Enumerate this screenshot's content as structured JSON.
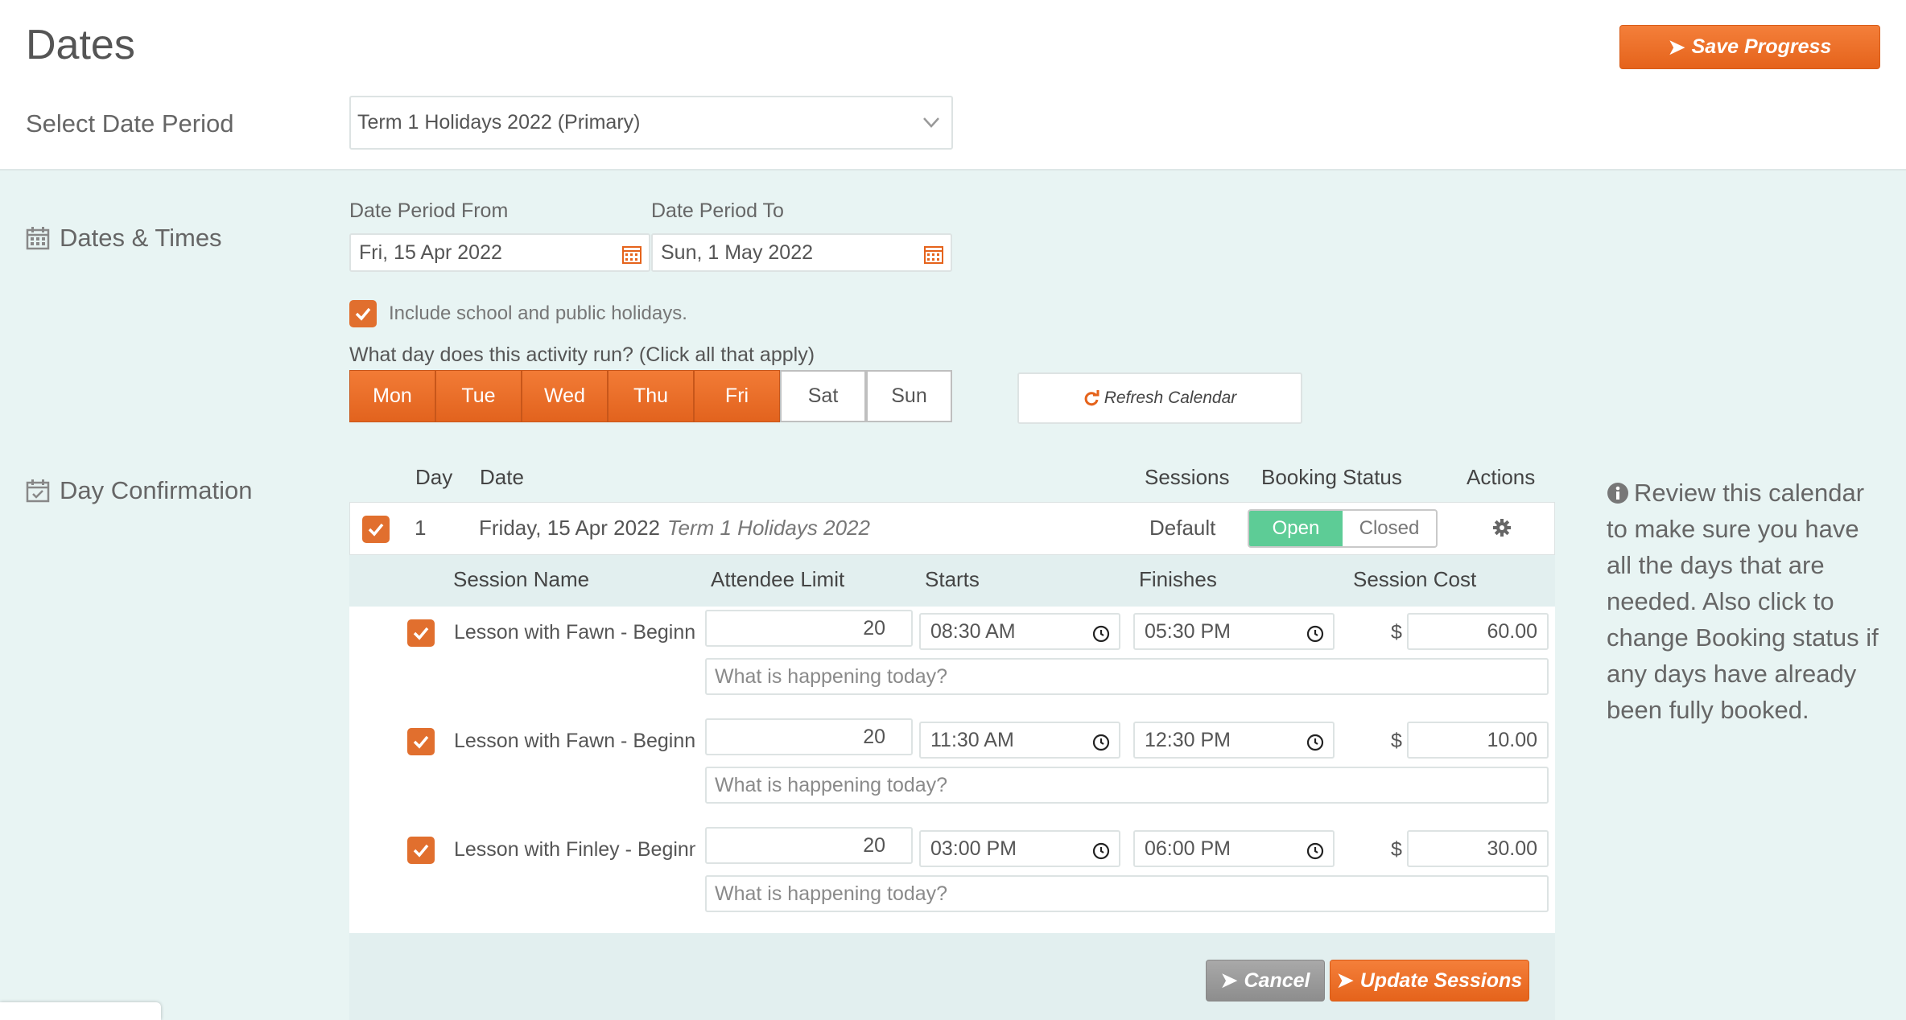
{
  "page": {
    "title": "Dates",
    "save_label": "Save Progress"
  },
  "date_period": {
    "label": "Select Date Period",
    "value": "Term 1 Holidays 2022 (Primary)"
  },
  "dates_times": {
    "label": "Dates & Times",
    "from_label": "Date Period From",
    "from_value": "Fri, 15 Apr 2022",
    "to_label": "Date Period To",
    "to_value": "Sun, 1 May 2022",
    "holidays_label": "Include school and public holidays.",
    "run_question": "What day does this activity run? (Click all that apply)",
    "days": [
      {
        "label": "Mon",
        "on": true
      },
      {
        "label": "Tue",
        "on": true
      },
      {
        "label": "Wed",
        "on": true
      },
      {
        "label": "Thu",
        "on": true
      },
      {
        "label": "Fri",
        "on": true
      },
      {
        "label": "Sat",
        "on": false
      },
      {
        "label": "Sun",
        "on": false
      }
    ],
    "refresh_label": "Refresh Calendar"
  },
  "confirmation": {
    "label": "Day Confirmation",
    "headers": {
      "day": "Day",
      "date": "Date",
      "sessions": "Sessions",
      "booking": "Booking Status",
      "actions": "Actions"
    },
    "row": {
      "day": "1",
      "date": "Friday, 15 Apr 2022",
      "term": "Term 1 Holidays 2022",
      "sessions": "Default",
      "open": "Open",
      "closed": "Closed"
    },
    "session_headers": {
      "name": "Session Name",
      "limit": "Attendee Limit",
      "starts": "Starts",
      "finishes": "Finishes",
      "cost": "Session Cost"
    },
    "sessions": [
      {
        "name": "Lesson with Fawn - Beginner",
        "limit": "20",
        "starts": "08:30 AM",
        "finishes": "05:30 PM",
        "currency": "$",
        "cost": "60.00",
        "note_placeholder": "What is happening today?"
      },
      {
        "name": "Lesson with Fawn - Beginner",
        "limit": "20",
        "starts": "11:30 AM",
        "finishes": "12:30 PM",
        "currency": "$",
        "cost": "10.00",
        "note_placeholder": "What is happening today?"
      },
      {
        "name": "Lesson with Finley - Beginner",
        "limit": "20",
        "starts": "03:00 PM",
        "finishes": "06:00 PM",
        "currency": "$",
        "cost": "30.00",
        "note_placeholder": "What is happening today?"
      }
    ],
    "cancel_label": "Cancel",
    "update_label": "Update Sessions"
  },
  "info": {
    "text": "Review this calendar to make sure you have all the days that are needed. Also click to change Booking status if any days have already been fully booked."
  },
  "colors": {
    "accent": "#e5631b",
    "open": "#5dcc96",
    "background": "#e8f4f3"
  }
}
